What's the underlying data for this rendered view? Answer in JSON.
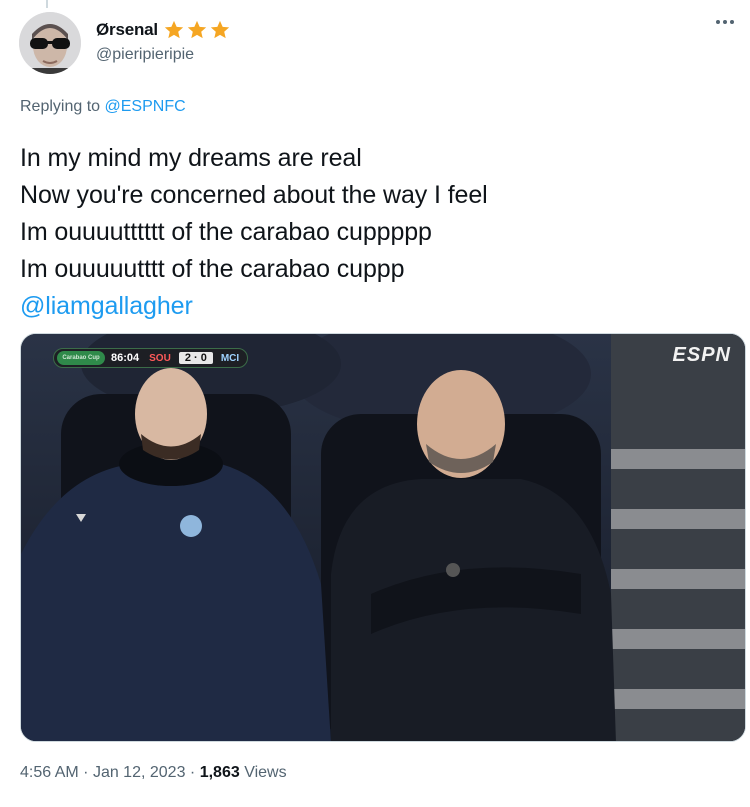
{
  "author": {
    "display_name": "Ørsenal",
    "handle": "@pieripieripie",
    "badge_icons": [
      "star-icon",
      "star-icon",
      "star-icon"
    ],
    "badge_color": "#f5a623"
  },
  "reply": {
    "prefix": "Replying to",
    "target": "@ESPNFC"
  },
  "tweet": {
    "lines": [
      "In my mind my dreams are real",
      "Now you're concerned about the way I feel",
      "Im ouuuutttttt of the carabao cuppppp",
      "Im ouuuuutttt of the carabao cuppp"
    ],
    "mention": "@liamgallagher"
  },
  "media": {
    "scorebug": {
      "competition": "Carabao Cup",
      "time": "86:04",
      "home": "SOU",
      "score": "2 · 0",
      "away": "MCI"
    },
    "broadcaster": "ESPN"
  },
  "meta": {
    "time": "4:56 AM",
    "separator": "·",
    "date": "Jan 12, 2023",
    "views_count": "1,863",
    "views_label": "Views"
  },
  "colors": {
    "link": "#1d9bf0",
    "secondary_text": "#536471",
    "primary_text": "#0f1419"
  }
}
